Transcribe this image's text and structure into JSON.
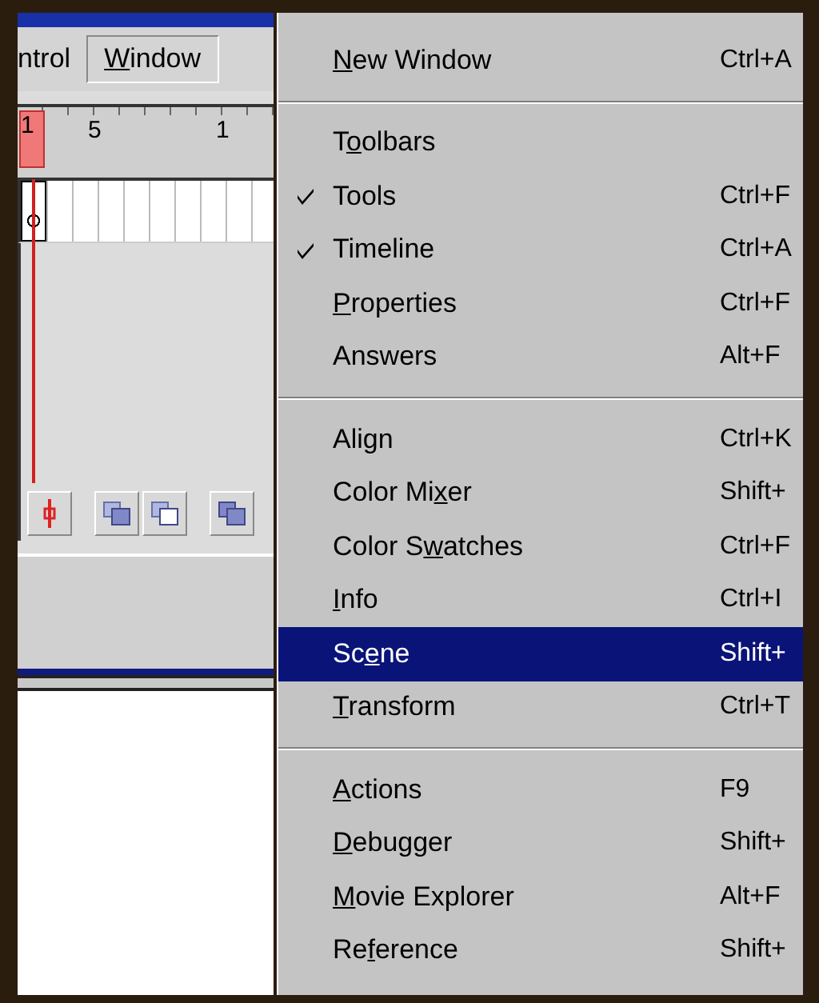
{
  "menubar": [
    {
      "pre": "ntrol",
      "selected": false
    },
    {
      "key": "W",
      "post": "indow",
      "selected": true
    }
  ],
  "timeline": {
    "ruler": [
      {
        "label": "1",
        "current": true
      },
      {
        "label": "5",
        "current": false
      },
      {
        "label": "1",
        "current": false
      }
    ]
  },
  "menu": {
    "groups": [
      [
        {
          "key": "N",
          "post": "ew Window",
          "shortcut": "Ctrl+A",
          "checked": false,
          "selected": false
        }
      ],
      [
        {
          "pre": "T",
          "key": "o",
          "post": "olbars",
          "checked": false,
          "selected": false
        },
        {
          "pre": "Tools",
          "shortcut": "Ctrl+F",
          "checked": true,
          "selected": false
        },
        {
          "pre": "Timeline",
          "shortcut": "Ctrl+A",
          "checked": true,
          "selected": false
        },
        {
          "key": "P",
          "post": "roperties",
          "shortcut": "Ctrl+F",
          "checked": false,
          "selected": false
        },
        {
          "pre": "Answers",
          "shortcut": "Alt+F",
          "checked": false,
          "selected": false
        }
      ],
      [
        {
          "pre": "Align",
          "shortcut": "Ctrl+K",
          "checked": false,
          "selected": false
        },
        {
          "pre": "Color Mi",
          "key": "x",
          "post": "er",
          "shortcut": "Shift+",
          "checked": false,
          "selected": false
        },
        {
          "pre": "Color S",
          "key": "w",
          "post": "atches",
          "shortcut": "Ctrl+F",
          "checked": false,
          "selected": false
        },
        {
          "key": "I",
          "post": "nfo",
          "shortcut": "Ctrl+I",
          "checked": false,
          "selected": false
        },
        {
          "pre": "Sc",
          "key": "e",
          "post": "ne",
          "shortcut": "Shift+",
          "checked": false,
          "selected": true
        },
        {
          "key": "T",
          "post": "ransform",
          "shortcut": "Ctrl+T",
          "checked": false,
          "selected": false
        }
      ],
      [
        {
          "key": "A",
          "post": "ctions",
          "shortcut": "F9",
          "checked": false,
          "selected": false
        },
        {
          "key": "D",
          "post": "ebugger",
          "shortcut": "Shift+",
          "checked": false,
          "selected": false
        },
        {
          "key": "M",
          "post": "ovie Explorer",
          "shortcut": "Alt+F",
          "checked": false,
          "selected": false
        },
        {
          "pre": "Re",
          "key": "f",
          "post": "erence",
          "shortcut": "Shift+",
          "checked": false,
          "selected": false
        }
      ]
    ]
  }
}
